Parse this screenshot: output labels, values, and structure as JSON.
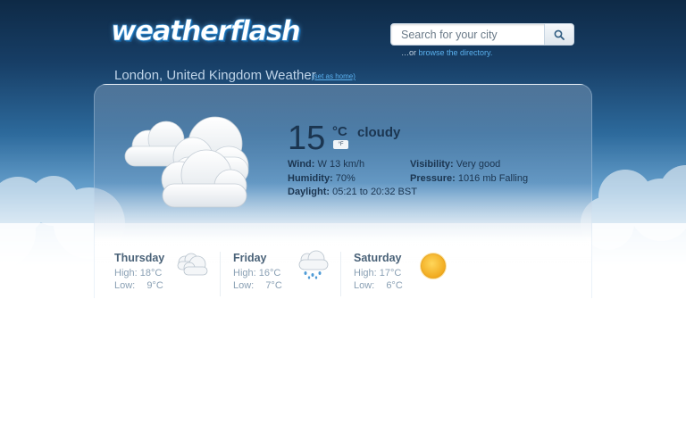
{
  "logo": "weatherflash",
  "search": {
    "placeholder": "Search for your city",
    "browse_prefix": "…or ",
    "browse_link": "browse the directory."
  },
  "location": {
    "title": "London, United Kingdom Weather",
    "set_home": "(set as home)"
  },
  "current": {
    "temperature": "15",
    "unit_celsius": "°C",
    "unit_fahrenheit": "°F",
    "condition": "cloudy",
    "icon": "cloudy-icon",
    "wind_label": "Wind:",
    "wind_value": "W 13 km/h",
    "humidity_label": "Humidity:",
    "humidity_value": "70%",
    "daylight_label": "Daylight:",
    "daylight_value": "05:21 to 20:32 BST",
    "visibility_label": "Visibility:",
    "visibility_value": "Very good",
    "pressure_label": "Pressure:",
    "pressure_value": "1016 mb Falling"
  },
  "forecast": [
    {
      "day": "Thursday",
      "high_label": "High:",
      "high": "18°C",
      "low_label": "Low:",
      "low": "9°C",
      "icon": "cloudy-icon"
    },
    {
      "day": "Friday",
      "high_label": "High:",
      "high": "16°C",
      "low_label": "Low:",
      "low": "7°C",
      "icon": "rain-cloud-icon"
    },
    {
      "day": "Saturday",
      "high_label": "High:",
      "high": "17°C",
      "low_label": "Low:",
      "low": "6°C",
      "icon": "sun-icon"
    }
  ],
  "colors": {
    "sky_dark": "#0e2a46",
    "link": "#5ab0ee",
    "text_dark": "#1b3550",
    "sun": "#f5b82a"
  }
}
